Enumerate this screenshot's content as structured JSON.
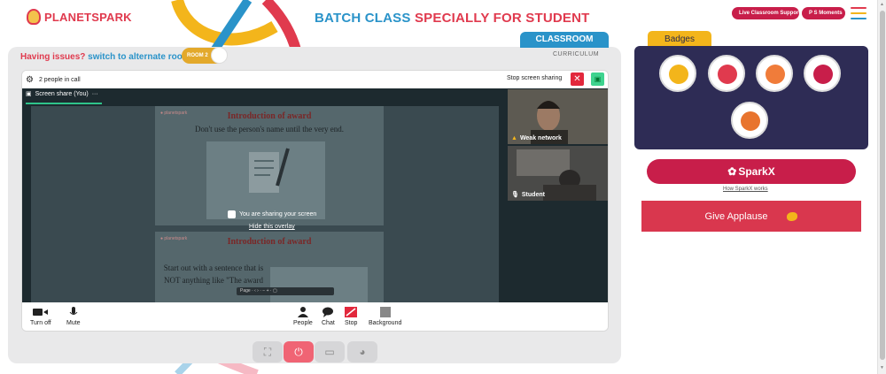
{
  "header": {
    "brand": "PLANETSPARK",
    "title_part1": "BATCH CLASS ",
    "title_part2": "SPECIALLY FOR STUDENT",
    "live_support": "Live Classroom Support",
    "moments": "P S Moments",
    "menu_icon": "hamburger-icon"
  },
  "tabs": {
    "classroom": "CLASSROOM",
    "curriculum": "CURRICULUM"
  },
  "issues": {
    "text": "Having issues?",
    "link": "switch to alternate room",
    "room_toggle": "ROOM 2"
  },
  "meeting": {
    "people_count": "2 people in call",
    "stop_sharing": "Stop screen sharing",
    "screen_share_label": "Screen share (You)",
    "overlay_message": "You are sharing your screen",
    "overlay_link": "Hide this overlay",
    "slide1": {
      "title": "Introduction of award",
      "subtitle": "Don't use the person's name until the very end."
    },
    "slide2": {
      "title": "Introduction of award",
      "body": "Start out with a sentence that is NOT anything like \"The award"
    },
    "participant1": {
      "status": "Weak network"
    },
    "participant2": {
      "name": "Student"
    },
    "controls": {
      "turn_off": "Turn off",
      "mute": "Mute",
      "people": "People",
      "chat": "Chat",
      "stop": "Stop",
      "background": "Background"
    }
  },
  "badges": {
    "title": "Badges",
    "items": [
      "badge-1",
      "badge-2",
      "badge-3",
      "badge-4",
      "badge-5"
    ]
  },
  "sparkx": {
    "button": "SparkX",
    "link": "How SparkX works"
  },
  "applause": {
    "button": "Give Applause"
  },
  "colors": {
    "brand_red": "#e03a4e",
    "brand_blue": "#2a93c9",
    "badge_panel": "#2e2c55",
    "badge_tab": "#f3b51b"
  }
}
